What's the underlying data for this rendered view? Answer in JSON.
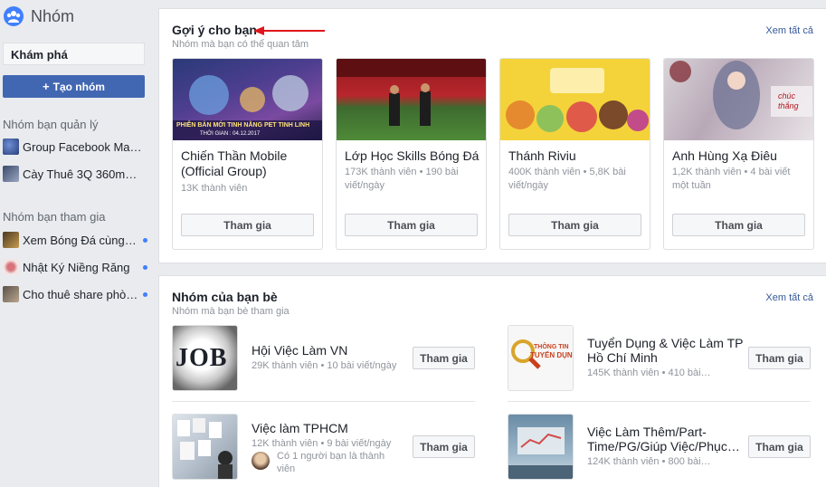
{
  "sidebar": {
    "title": "Nhóm",
    "search_value": "Khám phá",
    "create_label": "Tạo nhóm",
    "create_plus": "+",
    "managed_heading": "Nhóm bạn quản lý",
    "managed": [
      {
        "label": "Group Facebook Mar…"
      },
      {
        "label": "Cày Thuê 3Q 360mob…"
      }
    ],
    "joined_heading": "Nhóm bạn tham gia",
    "joined": [
      {
        "label": "Xem Bóng Đá cùng …"
      },
      {
        "label": "Nhật Ký Niềng Răng"
      },
      {
        "label": "Cho thuê share phò…"
      }
    ]
  },
  "suggested": {
    "title": "Gợi ý cho bạn",
    "subtitle": "Nhóm mà bạn có thể quan tâm",
    "see_all": "Xem tất cả",
    "cards": [
      {
        "name": "Chiến Thần Mobile (Official Group)",
        "meta": "13K thành viên",
        "button": "Tham gia",
        "banner": "PHIÊN BẢN MỚI TINH NĂNG PET TINH LINH",
        "banner_date": "THỜI GIAN : 04.12.2017"
      },
      {
        "name": "Lớp Học Skills Bóng Đá",
        "meta": "173K thành viên • 190 bài viết/ngày",
        "button": "Tham gia"
      },
      {
        "name": "Thánh Riviu",
        "meta": "400K thành viên • 5,8K bài viết/ngày",
        "button": "Tham gia"
      },
      {
        "name": "Anh Hùng Xạ Điêu",
        "meta": "1,2K thành viên • 4 bài viết một tuần",
        "button": "Tham gia",
        "banner": "chúc thắng"
      }
    ]
  },
  "friends": {
    "title": "Nhóm của bạn bè",
    "subtitle": "Nhóm mà bạn bè tham gia",
    "see_all": "Xem tất cả",
    "groups": [
      {
        "name": "Hội Việc Làm VN",
        "meta": "29K thành viên • 10 bài viết/ngày",
        "button": "Tham gia",
        "thumb_text": "JOB"
      },
      {
        "name": "Tuyển Dụng & Việc Làm TP Hồ Chí Minh",
        "meta": "145K thành viên • 410 bài…",
        "button": "Tham gia",
        "thumb_text1": "THÔNG TIN",
        "thumb_text2": "TUYỂN DỤNG"
      },
      {
        "name": "Việc làm TPHCM",
        "meta": "12K thành viên • 9 bài viết/ngày",
        "friend_note": "Có 1 người bạn là thành viên",
        "button": "Tham gia"
      },
      {
        "name": "Việc Làm Thêm/Part-Time/PG/Giúp Việc/Phục…",
        "meta": "124K thành viên • 800 bài…",
        "button": "Tham gia"
      }
    ]
  },
  "colors": {
    "brand": "#4267b2",
    "link": "#365899",
    "dot": "#4080ff",
    "arrow": "#e0161b"
  }
}
